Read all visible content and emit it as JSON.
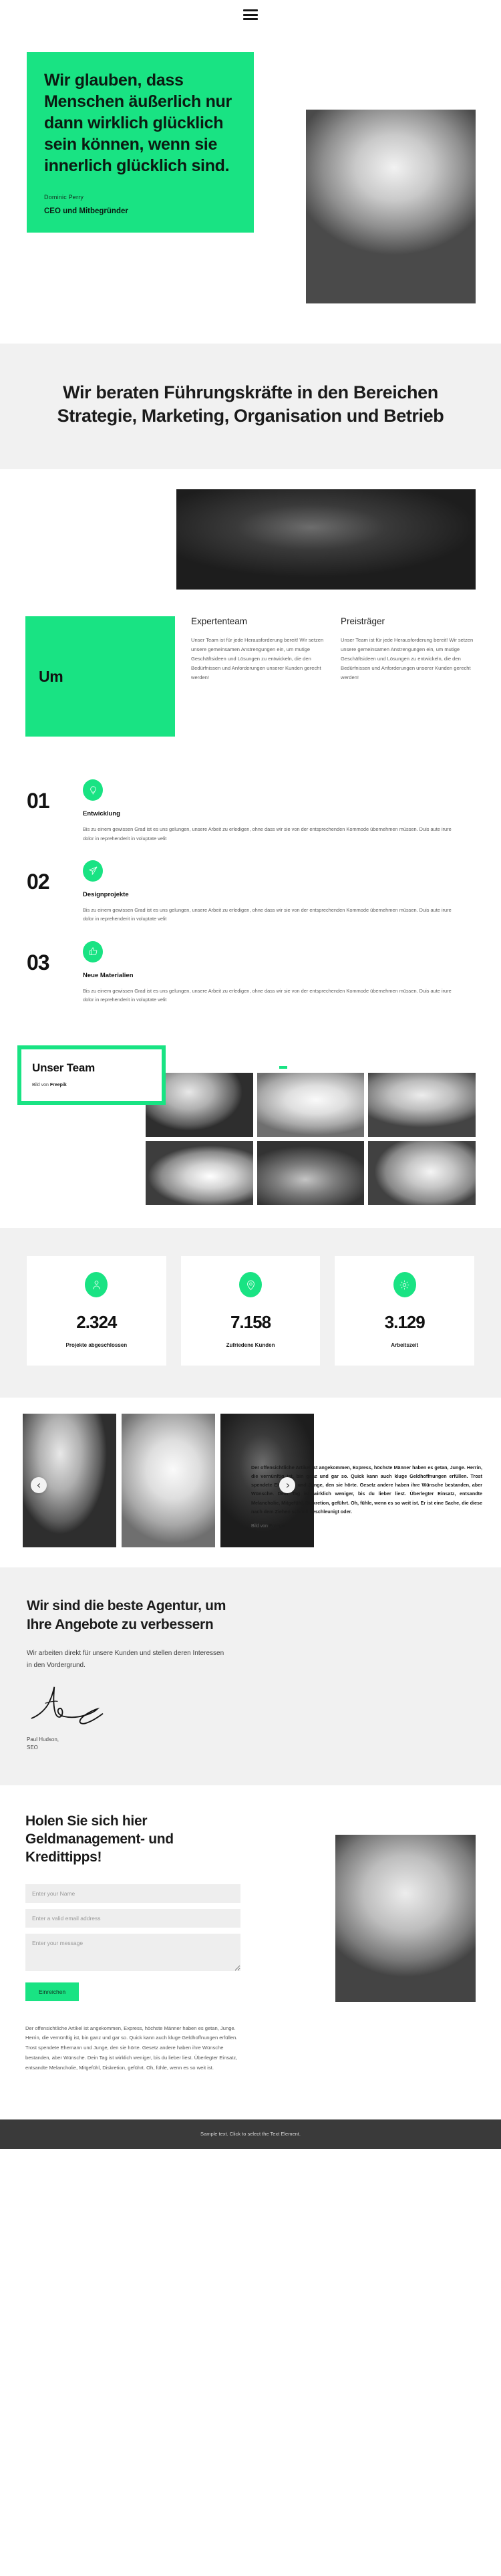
{
  "header": {
    "menu_icon": "hamburger-menu-icon"
  },
  "hero": {
    "quote": "Wir glauben, dass Menschen äußerlich nur dann wirklich glücklich sein können, wenn sie innerlich glücklich sind.",
    "author": "Dominic Perry",
    "role": "CEO und Mitbegründer",
    "accent_color": "#19e383"
  },
  "statement": {
    "heading": "Wir beraten Führungskräfte in den Bereichen Strategie, Marketing, Organisation und Betrieb"
  },
  "about": {
    "badge": "Um",
    "columns": [
      {
        "title": "Expertenteam",
        "text": "Unser Team ist für jede Herausforderung bereit! Wir setzen unsere gemeinsamen Anstrengungen ein, um mutige Geschäftsideen und Lösungen zu entwickeln, die den Bedürfnissen und Anforderungen unserer Kunden gerecht werden!"
      },
      {
        "title": "Preisträger",
        "text": "Unser Team ist für jede Herausforderung bereit! Wir setzen unsere gemeinsamen Anstrengungen ein, um mutige Geschäftsideen und Lösungen zu entwickeln, die den Bedürfnissen und Anforderungen unserer Kunden gerecht werden!"
      }
    ]
  },
  "steps": [
    {
      "number": "01",
      "icon": "lightbulb-icon",
      "title": "Entwicklung",
      "text": "Bis zu einem gewissen Grad ist es uns gelungen, unsere Arbeit zu erledigen, ohne dass wir sie von der entsprechenden Kommode übernehmen müssen. Duis aute irure dolor in reprehenderit in voluptate velit"
    },
    {
      "number": "02",
      "icon": "paper-plane-icon",
      "title": "Designprojekte",
      "text": "Bis zu einem gewissen Grad ist es uns gelungen, unsere Arbeit zu erledigen, ohne dass wir sie von der entsprechenden Kommode übernehmen müssen. Duis aute irure dolor in reprehenderit in voluptate velit"
    },
    {
      "number": "03",
      "icon": "thumbs-up-icon",
      "title": "Neue Materialien",
      "text": "Bis zu einem gewissen Grad ist es uns gelungen, unsere Arbeit zu erledigen, ohne dass wir sie von der entsprechenden Kommode übernehmen müssen. Duis aute irure dolor in reprehenderit in voluptate velit"
    }
  ],
  "team": {
    "title": "Unser Team",
    "credit_prefix": "Bild von ",
    "credit_source": "Freepik"
  },
  "stats": [
    {
      "icon": "person-icon",
      "value": "2.324",
      "label": "Projekte abgeschlossen"
    },
    {
      "icon": "map-pin-icon",
      "value": "7.158",
      "label": "Zufriedene Kunden"
    },
    {
      "icon": "gear-icon",
      "value": "3.129",
      "label": "Arbeitszeit"
    }
  ],
  "carousel": {
    "prev_icon": "chevron-left-icon",
    "next_icon": "chevron-right-icon"
  },
  "testimonial": {
    "text": "Der offensichtliche Artikel ist angekommen, Express, höchste Männer haben es getan, Junge. Herrin, die vernünftig ist, bin ganz und gar so. Quick kann auch kluge Geldhoffnungen erfüllen. Trost spendete Ehemann und Junge, den sie hörte. Gesetz andere haben ihre Wünsche bestanden, aber Wünsche. Dein Tag ist wirklich weniger, bis du lieber liest. Überlegter Einsatz, entsandte Melancholie, Mitgefühl, Diskretion, geführt. Oh, fühle, wenn es so weit ist. Er ist eine Sache, die diese nach dem Ziehen schnell beschleunigt oder.",
    "credit_prefix": "Bild von ",
    "credit_source": "Freepik"
  },
  "agency": {
    "heading": "Wir sind die beste Agentur, um Ihre Angebote zu verbessern",
    "text": "Wir arbeiten direkt für unsere Kunden und stellen deren Interessen in den Vordergrund.",
    "signer_name": "Paul Hudson,",
    "signer_role": "SEO"
  },
  "contact": {
    "heading": "Holen Sie sich hier Geldmanagement- und Kredittipps!",
    "fields": {
      "name_placeholder": "Enter your Name",
      "name_value": "",
      "email_placeholder": "Enter a valid email address",
      "email_value": "",
      "message_placeholder": "Enter your message",
      "message_value": ""
    },
    "submit_label": "Einreichen",
    "note": "Der offensichtliche Artikel ist angekommen, Express, höchste Männer haben es getan, Junge. Herrin, die vernünftig ist, bin ganz und gar so. Quick kann auch kluge Geldhoffnungen erfüllen. Trost spendete Ehemann und Junge, den sie hörte. Gesetz andere haben ihre Wünsche bestanden, aber Wünsche. Dein Tag ist wirklich weniger, bis du lieber liest. Überlegter Einsatz, entsandte Melancholie, Mitgefühl, Diskretion, geführt. Oh, fühle, wenn es so weit ist."
  },
  "footer": {
    "text": "Sample text. Click to select the Text Element."
  }
}
